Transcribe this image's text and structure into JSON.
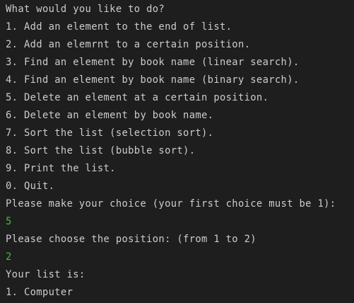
{
  "terminal": {
    "text_color": "#cccccc",
    "input_color": "#3cbf3c",
    "background": "#1e1e1e",
    "lines": [
      {
        "text": "What would you like to do?",
        "kind": "output"
      },
      {
        "text": "1. Add an element to the end of list.",
        "kind": "output"
      },
      {
        "text": "2. Add an elemrnt to a certain position.",
        "kind": "output"
      },
      {
        "text": "3. Find an element by book name (linear search).",
        "kind": "output"
      },
      {
        "text": "4. Find an element by book name (binary search).",
        "kind": "output"
      },
      {
        "text": "5. Delete an element at a certain position.",
        "kind": "output"
      },
      {
        "text": "6. Delete an element by book name.",
        "kind": "output"
      },
      {
        "text": "7. Sort the list (selection sort).",
        "kind": "output"
      },
      {
        "text": "8. Sort the list (bubble sort).",
        "kind": "output"
      },
      {
        "text": "9. Print the list.",
        "kind": "output"
      },
      {
        "text": "0. Quit.",
        "kind": "output"
      },
      {
        "text": "Please make your choice (your first choice must be 1):",
        "kind": "output"
      },
      {
        "text": "5",
        "kind": "input"
      },
      {
        "text": "Please choose the position: (from 1 to 2)",
        "kind": "output"
      },
      {
        "text": "2",
        "kind": "input"
      },
      {
        "text": "Your list is:",
        "kind": "output"
      },
      {
        "text": "1. Computer",
        "kind": "output"
      }
    ]
  }
}
